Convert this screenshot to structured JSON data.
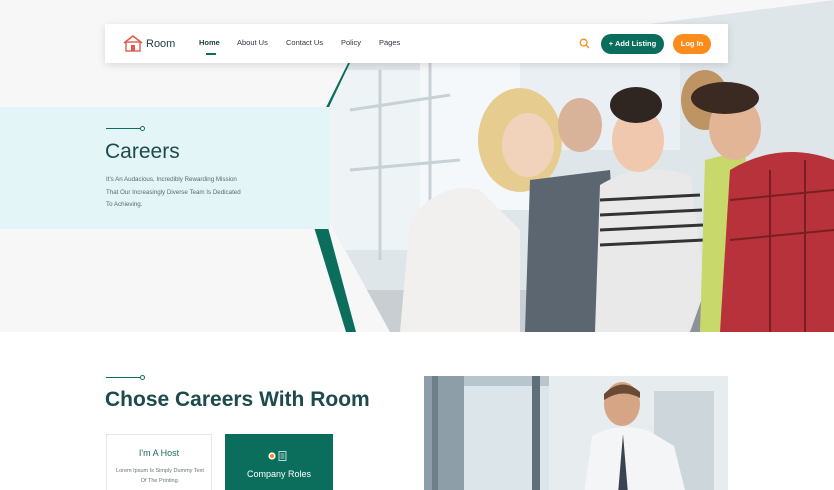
{
  "nav": {
    "logo_text": "Room",
    "links": [
      "Home",
      "About Us",
      "Contact Us",
      "Policy",
      "Pages"
    ],
    "active": "Home",
    "add_listing_label": "+ Add Listing",
    "login_label": "Log In",
    "search_icon": "search-icon"
  },
  "hero": {
    "title": "Careers",
    "description": "It's An Audacious, Incredibly Rewarding Mission That Our Increasingly Diverse Team Is Dedicated To Achieving."
  },
  "section": {
    "title": "Chose Careers With Room",
    "cards": [
      {
        "title": "I'm A Host",
        "description": "Lorem Ipsum Is Simply Dummy Text Of The Printing."
      },
      {
        "title": "Company Roles",
        "icon": "roles-icon"
      }
    ]
  },
  "colors": {
    "brand_green": "#0b6e5d",
    "accent_orange": "#fb8c1b",
    "hero_tint": "#e3f5f6"
  }
}
